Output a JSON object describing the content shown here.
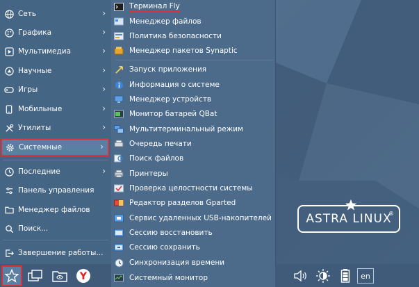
{
  "menu": {
    "categories": [
      {
        "label": "Сеть",
        "icon": "globe-icon"
      },
      {
        "label": "Графика",
        "icon": "palette-icon"
      },
      {
        "label": "Мультимедиа",
        "icon": "play-icon"
      },
      {
        "label": "Научные",
        "icon": "science-icon"
      },
      {
        "label": "Игры",
        "icon": "gamepad-icon"
      },
      {
        "label": "Мобильные",
        "icon": "phone-icon"
      },
      {
        "label": "Утилиты",
        "icon": "tools-icon"
      },
      {
        "label": "Системные",
        "icon": "gear-icon"
      }
    ],
    "bottom": [
      {
        "label": "Последние",
        "icon": "history-icon"
      },
      {
        "label": "Панель управления",
        "icon": "control-panel-icon"
      },
      {
        "label": "Менеджер файлов",
        "icon": "folder-icon"
      },
      {
        "label": "Поиск...",
        "icon": "search-icon"
      },
      {
        "label": "Завершение работы...",
        "icon": "logout-icon"
      }
    ]
  },
  "submenu": {
    "items": [
      {
        "label": "Терминал Fly",
        "icon": "terminal-icon"
      },
      {
        "label": "Менеджер файлов",
        "icon": "file-manager-icon"
      },
      {
        "label": "Политика безопасности",
        "icon": "security-policy-icon"
      },
      {
        "label": "Менеджер пакетов Synaptic",
        "icon": "package-icon"
      },
      {
        "label": "Запуск приложения",
        "icon": "run-icon"
      },
      {
        "label": "Информация о системе",
        "icon": "info-icon"
      },
      {
        "label": "Менеджер устройств",
        "icon": "devices-icon"
      },
      {
        "label": "Монитор батарей QBat",
        "icon": "battery-monitor-icon"
      },
      {
        "label": "Мультитерминальный режим",
        "icon": "multiterminal-icon"
      },
      {
        "label": "Очередь печати",
        "icon": "print-queue-icon"
      },
      {
        "label": "Поиск файлов",
        "icon": "file-search-icon"
      },
      {
        "label": "Принтеры",
        "icon": "printer-icon"
      },
      {
        "label": "Проверка целостности системы",
        "icon": "integrity-icon"
      },
      {
        "label": "Редактор разделов Gparted",
        "icon": "gparted-icon"
      },
      {
        "label": "Сервис удаленных USB-накопителей",
        "icon": "usb-icon"
      },
      {
        "label": "Сессию восстановить",
        "icon": "session-restore-icon"
      },
      {
        "label": "Сессию сохранить",
        "icon": "session-save-icon"
      },
      {
        "label": "Синхронизация времени",
        "icon": "time-sync-icon"
      },
      {
        "label": "Системный монитор",
        "icon": "system-monitor-icon"
      }
    ]
  },
  "logo": {
    "text": "ASTRA LINUX",
    "reg": "®"
  },
  "tray": {
    "lang": "en"
  },
  "colors": {
    "accent_red": "#d9323a",
    "panel": "#456584",
    "highlight": "#5b7ea3"
  }
}
